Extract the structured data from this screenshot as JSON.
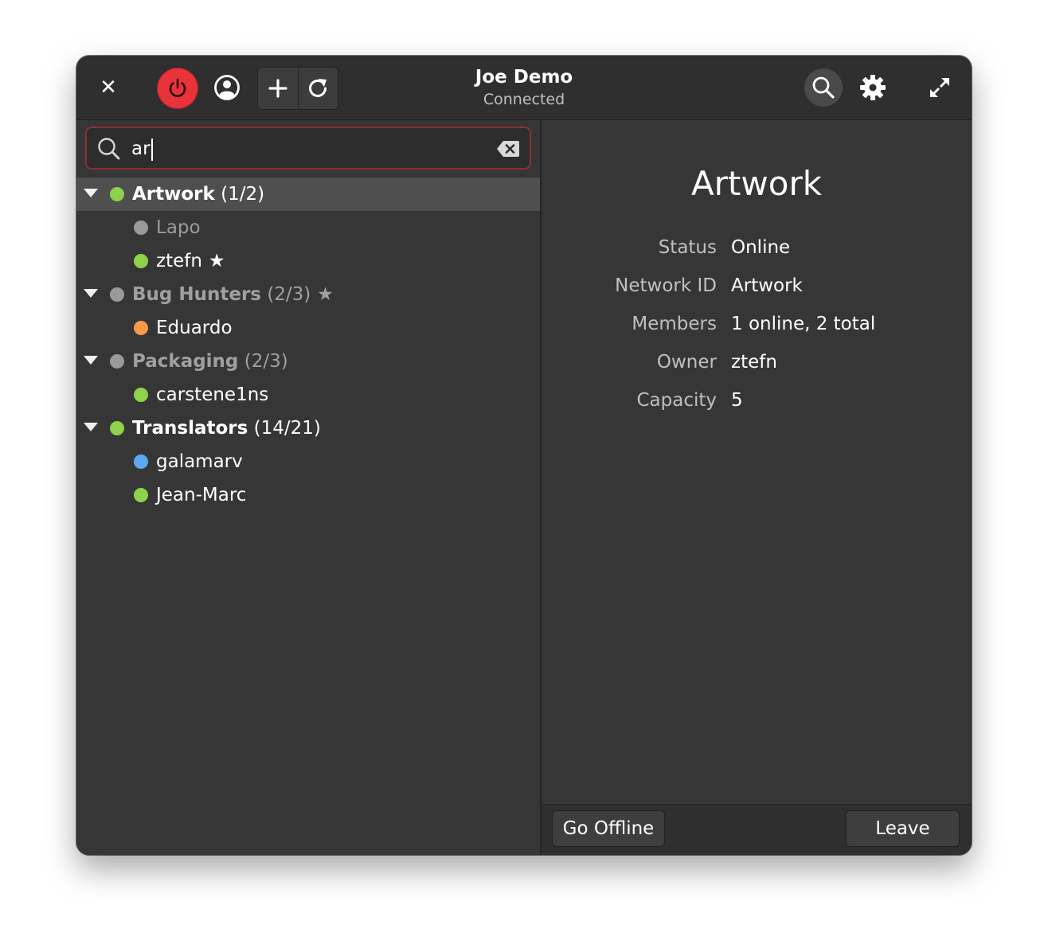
{
  "header": {
    "title": "Joe Demo",
    "subtitle": "Connected",
    "close_glyph": "✕",
    "icons": {
      "close": "close-icon",
      "power": "power-icon",
      "user": "user-icon",
      "add": "plus-icon",
      "refresh": "refresh-icon",
      "search": "search-icon",
      "settings": "gear-icon",
      "expand": "expand-icon"
    },
    "colors": {
      "power_bg": "#e8333b"
    }
  },
  "search": {
    "value": "ar"
  },
  "tree": {
    "groups": [
      {
        "name": "Artwork",
        "count": "(1/2)",
        "status": "online",
        "star": "",
        "selected": true,
        "members": [
          {
            "name": "Lapo",
            "status": "offline",
            "star": ""
          },
          {
            "name": "ztefn",
            "status": "online",
            "star": "★"
          }
        ]
      },
      {
        "name": "Bug Hunters",
        "count": "(2/3)",
        "status": "offline",
        "star": "★",
        "selected": false,
        "members": [
          {
            "name": "Eduardo",
            "status": "away",
            "star": ""
          }
        ]
      },
      {
        "name": "Packaging",
        "count": "(2/3)",
        "status": "offline",
        "star": "",
        "selected": false,
        "members": [
          {
            "name": "carstene1ns",
            "status": "online",
            "star": ""
          }
        ]
      },
      {
        "name": "Translators",
        "count": "(14/21)",
        "status": "online",
        "star": "",
        "selected": false,
        "members": [
          {
            "name": "galamarv",
            "status": "busy",
            "star": ""
          },
          {
            "name": "Jean-Marc",
            "status": "online",
            "star": ""
          }
        ]
      }
    ],
    "status_colors": {
      "online": "#8ed14a",
      "offline": "#9a9a9a",
      "away": "#f79a4a",
      "busy": "#5aa9f0"
    }
  },
  "details": {
    "title": "Artwork",
    "rows": [
      {
        "key": "Status",
        "value": "Online"
      },
      {
        "key": "Network ID",
        "value": "Artwork"
      },
      {
        "key": "Members",
        "value": "1 online, 2 total"
      },
      {
        "key": "Owner",
        "value": "ztefn"
      },
      {
        "key": "Capacity",
        "value": "5"
      }
    ]
  },
  "footer": {
    "go_offline_label": "Go Offline",
    "leave_label": "Leave"
  }
}
